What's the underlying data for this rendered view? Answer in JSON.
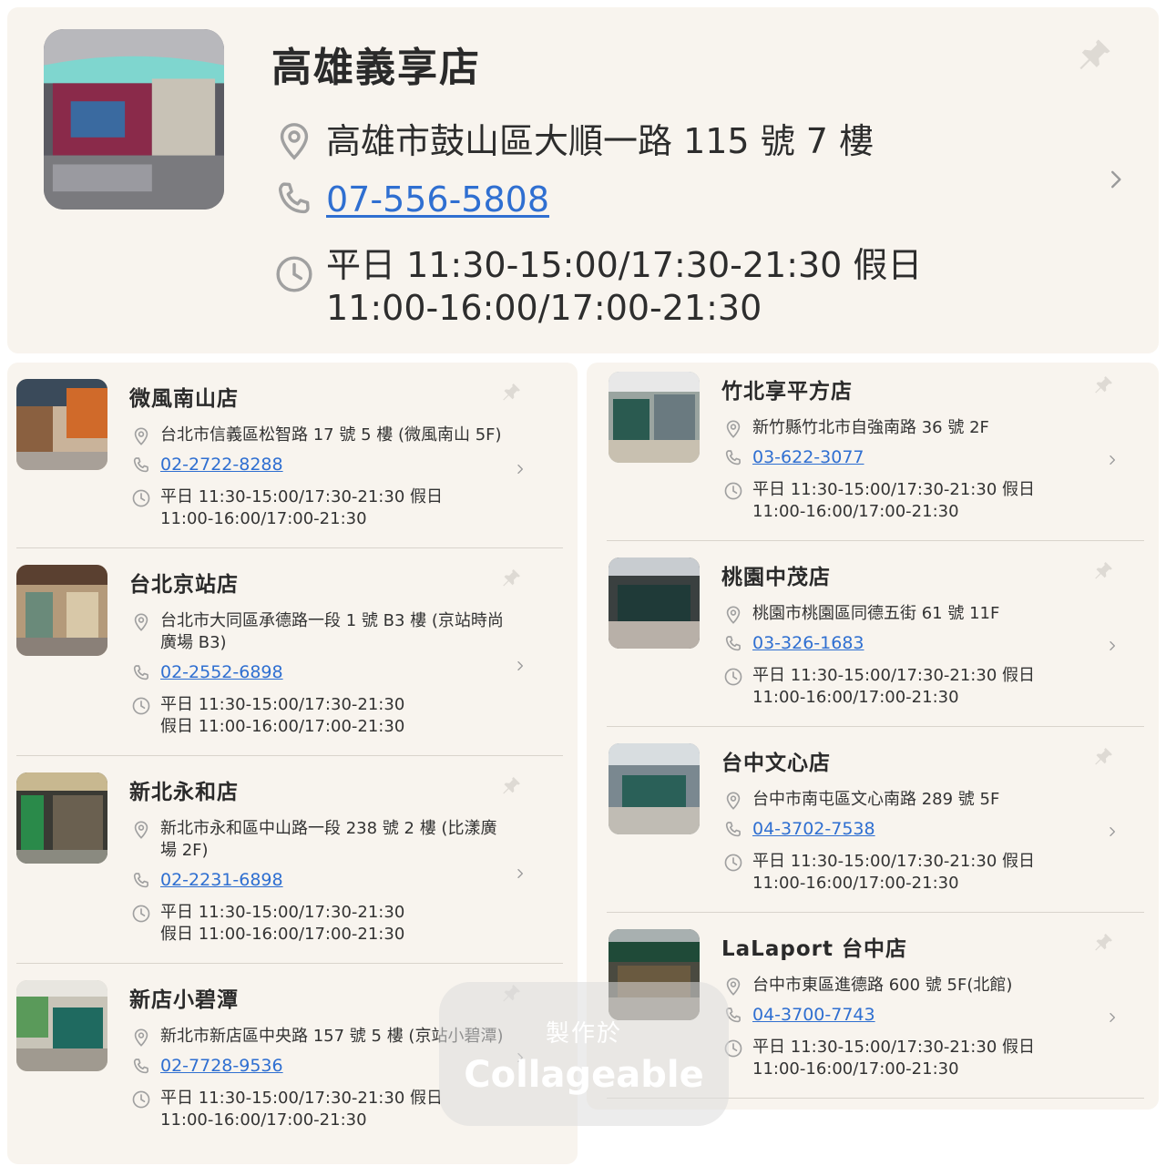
{
  "colors": {
    "panel_bg": "#f8f4ee",
    "link": "#2f6fd1",
    "icon_gray": "#a0a0a0"
  },
  "featured": {
    "name": "高雄義享店",
    "address": "高雄市鼓山區大順一路 115 號 7 樓",
    "phone": "07-556-5808",
    "hours_line1": "平日 11:30-15:00/17:30-21:30 假日",
    "hours_line2": "11:00-16:00/17:00-21:30"
  },
  "left_stores": [
    {
      "name": "微風南山店",
      "address_line1": "台北市信義區松智路 17 號 5 樓 (微風南山 5F)",
      "address_line2": "",
      "phone": "02-2722-8288",
      "hours_line1": "平日 11:30-15:00/17:30-21:30 假日",
      "hours_line2": "11:00-16:00/17:00-21:30"
    },
    {
      "name": "台北京站店",
      "address_line1": "台北市大同區承德路一段 1 號 B3 樓 (京站時尚",
      "address_line2": "廣場 B3)",
      "phone": "02-2552-6898",
      "hours_line1": "平日 11:30-15:00/17:30-21:30",
      "hours_line2": "假日 11:00-16:00/17:00-21:30"
    },
    {
      "name": "新北永和店",
      "address_line1": "新北市永和區中山路一段 238 號 2 樓 (比漾廣",
      "address_line2": "場 2F)",
      "phone": "02-2231-6898",
      "hours_line1": "平日 11:30-15:00/17:30-21:30",
      "hours_line2": "假日 11:00-16:00/17:00-21:30"
    },
    {
      "name": "新店小碧潭",
      "address_line1": "新北市新店區中央路 157 號 5 樓 (京站小碧潭)",
      "address_line2": "",
      "phone": "02-7728-9536",
      "hours_line1": "平日 11:30-15:00/17:30-21:30 假日",
      "hours_line2": "11:00-16:00/17:00-21:30"
    }
  ],
  "right_stores": [
    {
      "name": "竹北享平方店",
      "address_line1": "新竹縣竹北市自強南路 36 號 2F",
      "phone": "03-622-3077",
      "hours_line1": "平日 11:30-15:00/17:30-21:30 假日",
      "hours_line2": "11:00-16:00/17:00-21:30"
    },
    {
      "name": "桃園中茂店",
      "address_line1": "桃園市桃園區同德五街 61 號 11F",
      "phone": "03-326-1683",
      "hours_line1": "平日 11:30-15:00/17:30-21:30 假日",
      "hours_line2": "11:00-16:00/17:00-21:30"
    },
    {
      "name": "台中文心店",
      "address_line1": "台中市南屯區文心南路 289 號 5F",
      "phone": "04-3702-7538",
      "hours_line1": "平日 11:30-15:00/17:30-21:30 假日",
      "hours_line2": "11:00-16:00/17:00-21:30"
    },
    {
      "name": "LaLaport 台中店",
      "address_line1": "台中市東區進德路 600 號 5F(北館)",
      "phone": "04-3700-7743",
      "hours_line1": "平日 11:30-15:00/17:30-21:30 假日",
      "hours_line2": "11:00-16:00/17:00-21:30"
    }
  ],
  "watermark": {
    "line1": "製作於",
    "line2": "Collageable"
  }
}
